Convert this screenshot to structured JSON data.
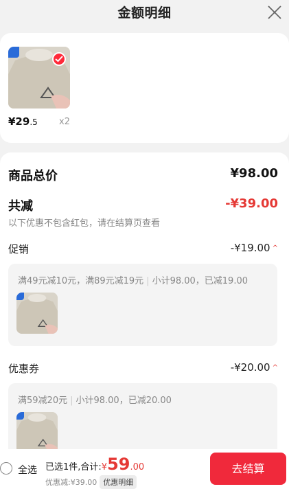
{
  "header": {
    "title": "金额明细"
  },
  "product": {
    "price_int": "¥29",
    "price_dec": ".5",
    "qty": "x2"
  },
  "summary": {
    "total_label": "商品总价",
    "total_value": "¥98.00",
    "reduce_label": "共减",
    "reduce_value": "-¥39.00",
    "note": "以下优惠不包含红包，请在结算页查看"
  },
  "promo": {
    "label": "促销",
    "value": "-¥19.00",
    "chevron": "^",
    "rule": "满49元减10元，满89元减19元",
    "detail": "小计98.00，已减19.00"
  },
  "coupon": {
    "label": "优惠券",
    "value": "-¥20.00",
    "chevron": "^",
    "rule": "满59减20元",
    "detail": "小计98.00，已减20.00"
  },
  "bottom": {
    "select_all": "全选",
    "selected_text": "已选1件,合计:",
    "currency": "¥",
    "total_int": "59",
    "total_dec": ".00",
    "discount_text": "优惠减:¥39.00",
    "detail_button": "优惠明细",
    "checkout_button": "去结算"
  },
  "colors": {
    "accent": "#e53935",
    "checkout_bg": "#f0293b"
  }
}
